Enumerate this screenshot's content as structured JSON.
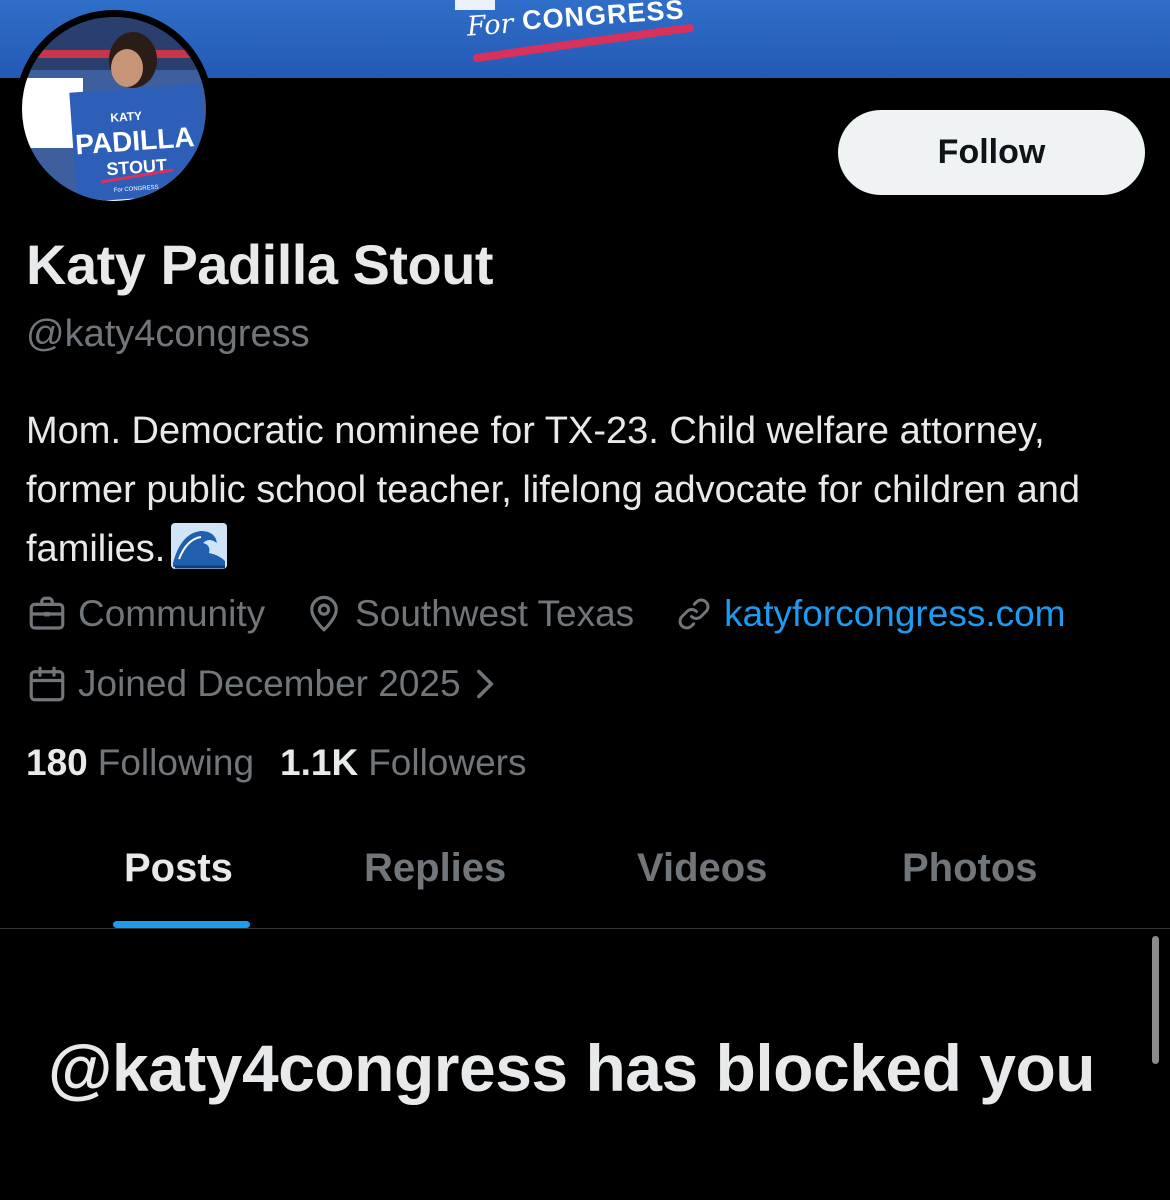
{
  "banner": {
    "for_text": "For",
    "congress_text": "CONGRESS",
    "color": "#2a63bf"
  },
  "avatar": {
    "sign_line1": "KATY",
    "sign_line2": "PADILLA",
    "sign_line3": "STOUT",
    "sign_line4": "For CONGRESS"
  },
  "profile": {
    "follow_label": "Follow",
    "display_name": "Katy Padilla Stout",
    "handle": "@katy4congress",
    "bio": "Mom. Democratic nominee for TX-23. Child welfare attorney, former public school teacher, lifelong advocate for children and families.",
    "bio_emoji": "water-wave-icon",
    "category": "Community",
    "location": "Southwest Texas",
    "website": "katyforcongress.com",
    "joined": "Joined December 2025",
    "following_count": "180",
    "following_label": "Following",
    "followers_count": "1.1K",
    "followers_label": "Followers"
  },
  "tabs": [
    {
      "label": "Posts",
      "active": true
    },
    {
      "label": "Replies",
      "active": false
    },
    {
      "label": "Videos",
      "active": false
    },
    {
      "label": "Photos",
      "active": false
    }
  ],
  "blocked_message": "@katy4congress has blocked you",
  "colors": {
    "background": "#000000",
    "text": "#e7e9ea",
    "secondary_text": "#71767b",
    "accent": "#1d9bf0"
  }
}
